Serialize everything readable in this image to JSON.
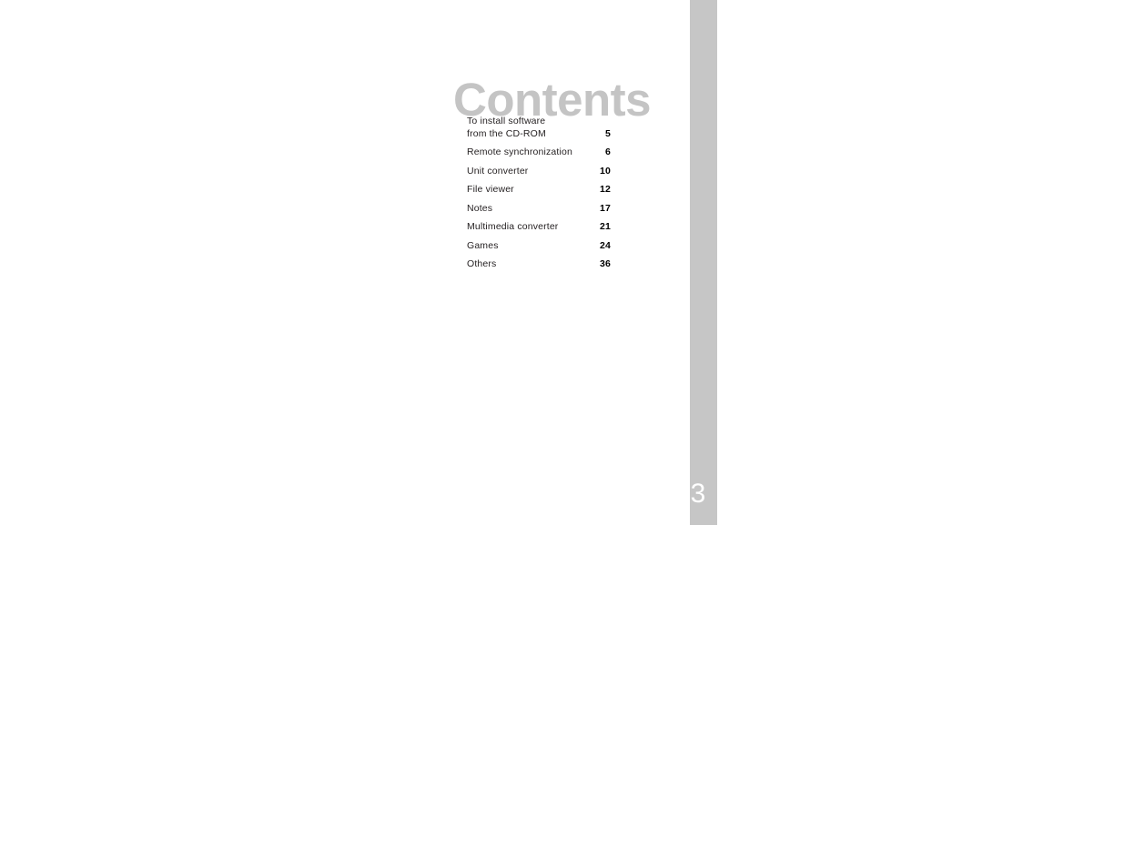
{
  "page": {
    "title": "Contents",
    "number": "3",
    "background_color": "#ffffff",
    "title_color": "#c4c4c4",
    "edge_bar_color": "#c6c6c6",
    "page_number_color": "#ffffff",
    "text_color": "#231f20"
  },
  "toc": {
    "entries": [
      {
        "label": "To install software\nfrom the CD-ROM",
        "page": "5"
      },
      {
        "label": "Remote synchronization",
        "page": "6"
      },
      {
        "label": "Unit converter",
        "page": "10"
      },
      {
        "label": "File viewer",
        "page": "12"
      },
      {
        "label": "Notes",
        "page": "17"
      },
      {
        "label": "Multimedia converter",
        "page": "21"
      },
      {
        "label": "Games",
        "page": "24"
      },
      {
        "label": "Others",
        "page": "36"
      }
    ]
  }
}
